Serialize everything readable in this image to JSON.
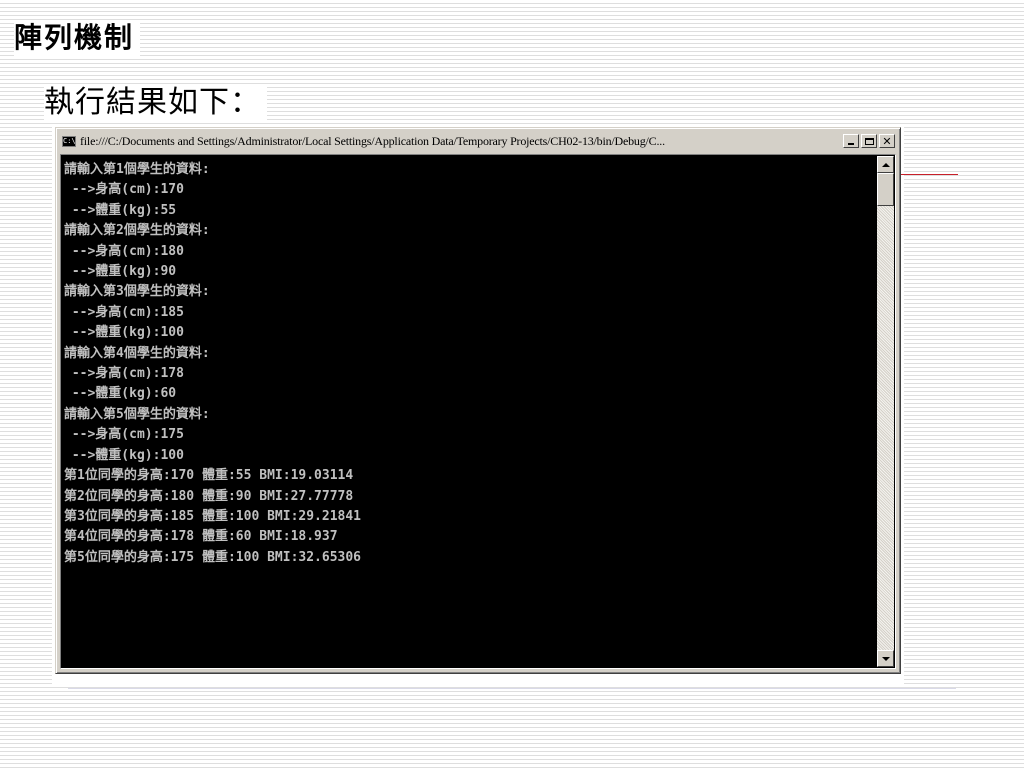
{
  "slide": {
    "title": "陣列機制",
    "subtitle": "執行結果如下："
  },
  "window": {
    "title": "file:///C:/Documents and Settings/Administrator/Local Settings/Application Data/Temporary Projects/CH02-13/bin/Debug/C...",
    "app_icon": "command-prompt-icon",
    "app_icon_text": "C:\\",
    "buttons": {
      "minimize": "minimize-icon",
      "maximize": "maximize-icon",
      "close": "close-icon",
      "close_glyph": "✕"
    }
  },
  "console": {
    "text_color": "#c0c0c0",
    "background": "#000000",
    "lines": [
      "請輸入第1個學生的資料:",
      " -->身高(cm):170",
      " -->體重(kg):55",
      "請輸入第2個學生的資料:",
      " -->身高(cm):180",
      " -->體重(kg):90",
      "請輸入第3個學生的資料:",
      " -->身高(cm):185",
      " -->體重(kg):100",
      "請輸入第4個學生的資料:",
      " -->身高(cm):178",
      " -->體重(kg):60",
      "請輸入第5個學生的資料:",
      " -->身高(cm):175",
      " -->體重(kg):100",
      "第1位同學的身高:170 體重:55 BMI:19.03114",
      "第2位同學的身高:180 體重:90 BMI:27.77778",
      "第3位同學的身高:185 體重:100 BMI:29.21841",
      "第4位同學的身高:178 體重:60 BMI:18.937",
      "第5位同學的身高:175 體重:100 BMI:32.65306"
    ]
  },
  "scrollbar": {
    "up_icon": "scroll-up-arrow-icon",
    "down_icon": "scroll-down-arrow-icon",
    "position": 0
  },
  "colors": {
    "accent_line": "#c8202a",
    "window_chrome": "#d4d0c8"
  }
}
